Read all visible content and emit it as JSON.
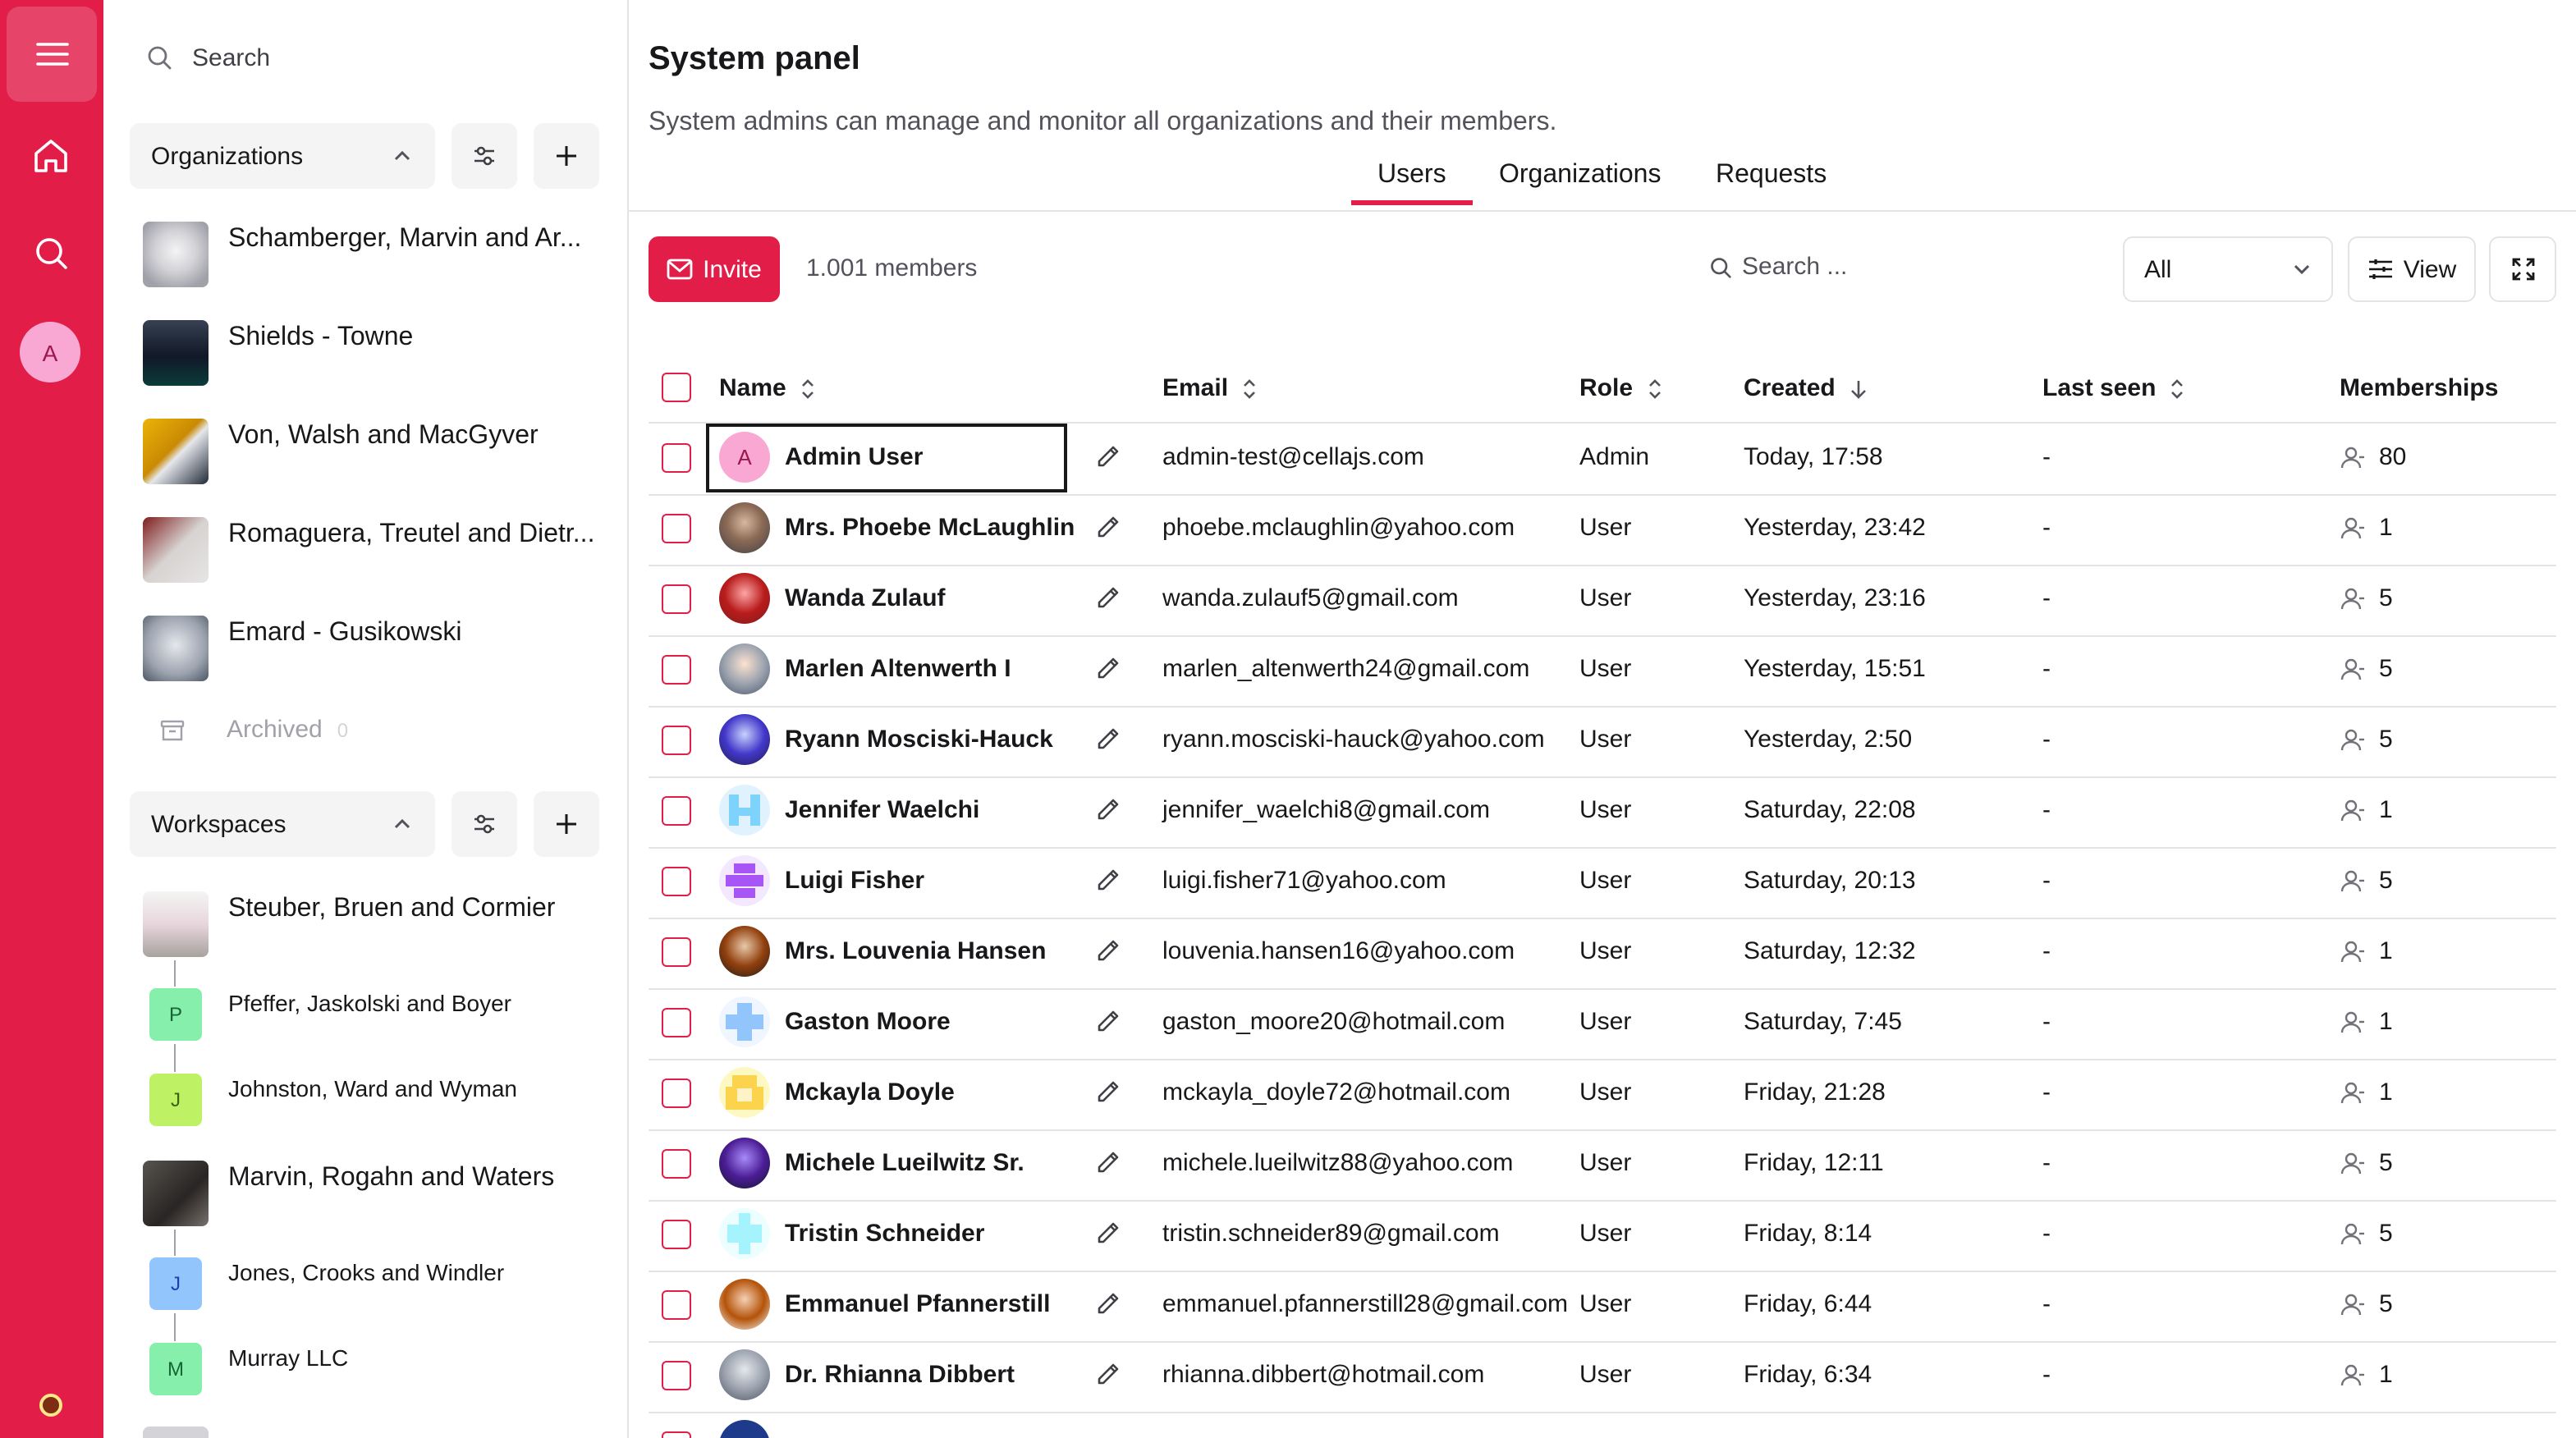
{
  "rail": {
    "avatar_initial": "A",
    "accent": "#e11d48"
  },
  "sidebar": {
    "search_placeholder": "Search",
    "organizations": {
      "title": "Organizations",
      "items": [
        {
          "name": "Schamberger, Marvin and Ar..."
        },
        {
          "name": "Shields - Towne"
        },
        {
          "name": "Von, Walsh and MacGyver"
        },
        {
          "name": "Romaguera, Treutel and Dietr..."
        },
        {
          "name": "Emard - Gusikowski"
        }
      ],
      "archived_label": "Archived",
      "archived_count": "0"
    },
    "workspaces": {
      "title": "Workspaces",
      "items": [
        {
          "name": "Steuber, Bruen and Cormier",
          "children": [
            {
              "initial": "P",
              "name": "Pfeffer, Jaskolski and Boyer"
            },
            {
              "initial": "J",
              "name": "Johnston, Ward and Wyman"
            }
          ]
        },
        {
          "name": "Marvin, Rogahn and Waters",
          "children": [
            {
              "initial": "J",
              "name": "Jones, Crooks and Windler"
            },
            {
              "initial": "M",
              "name": "Murray LLC"
            }
          ]
        }
      ]
    }
  },
  "main": {
    "title": "System panel",
    "description": "System admins can manage and monitor all organizations and their members.",
    "tabs": [
      {
        "label": "Users",
        "active": true
      },
      {
        "label": "Organizations",
        "active": false
      },
      {
        "label": "Requests",
        "active": false
      }
    ],
    "toolbar": {
      "invite_label": "Invite",
      "member_count": "1.001 members",
      "search_placeholder": "Search ...",
      "filter_value": "All",
      "view_label": "View"
    },
    "table": {
      "columns": [
        "Name",
        "Email",
        "Role",
        "Created",
        "Last seen",
        "Memberships"
      ],
      "rows": [
        {
          "name": "Admin User",
          "email": "admin-test@cellajs.com",
          "role": "Admin",
          "created": "Today, 17:58",
          "last_seen": "-",
          "memberships": "80",
          "avatar": "initial",
          "initial": "A"
        },
        {
          "name": "Mrs. Phoebe McLaughlin",
          "email": "phoebe.mclaughlin@yahoo.com",
          "role": "User",
          "created": "Yesterday, 23:42",
          "last_seen": "-",
          "memberships": "1",
          "avatar": "photo"
        },
        {
          "name": "Wanda Zulauf",
          "email": "wanda.zulauf5@gmail.com",
          "role": "User",
          "created": "Yesterday, 23:16",
          "last_seen": "-",
          "memberships": "5",
          "avatar": "photo"
        },
        {
          "name": "Marlen Altenwerth I",
          "email": "marlen_altenwerth24@gmail.com",
          "role": "User",
          "created": "Yesterday, 15:51",
          "last_seen": "-",
          "memberships": "5",
          "avatar": "photo"
        },
        {
          "name": "Ryann Mosciski-Hauck",
          "email": "ryann.mosciski-hauck@yahoo.com",
          "role": "User",
          "created": "Yesterday, 2:50",
          "last_seen": "-",
          "memberships": "5",
          "avatar": "photo"
        },
        {
          "name": "Jennifer Waelchi",
          "email": "jennifer_waelchi8@gmail.com",
          "role": "User",
          "created": "Saturday, 22:08",
          "last_seen": "-",
          "memberships": "1",
          "avatar": "pattern"
        },
        {
          "name": "Luigi Fisher",
          "email": "luigi.fisher71@yahoo.com",
          "role": "User",
          "created": "Saturday, 20:13",
          "last_seen": "-",
          "memberships": "5",
          "avatar": "pattern"
        },
        {
          "name": "Mrs. Louvenia Hansen",
          "email": "louvenia.hansen16@yahoo.com",
          "role": "User",
          "created": "Saturday, 12:32",
          "last_seen": "-",
          "memberships": "1",
          "avatar": "photo"
        },
        {
          "name": "Gaston Moore",
          "email": "gaston_moore20@hotmail.com",
          "role": "User",
          "created": "Saturday, 7:45",
          "last_seen": "-",
          "memberships": "1",
          "avatar": "pattern"
        },
        {
          "name": "Mckayla Doyle",
          "email": "mckayla_doyle72@hotmail.com",
          "role": "User",
          "created": "Friday, 21:28",
          "last_seen": "-",
          "memberships": "1",
          "avatar": "pattern"
        },
        {
          "name": "Michele Lueilwitz Sr.",
          "email": "michele.lueilwitz88@yahoo.com",
          "role": "User",
          "created": "Friday, 12:11",
          "last_seen": "-",
          "memberships": "5",
          "avatar": "photo"
        },
        {
          "name": "Tristin Schneider",
          "email": "tristin.schneider89@gmail.com",
          "role": "User",
          "created": "Friday, 8:14",
          "last_seen": "-",
          "memberships": "5",
          "avatar": "pattern"
        },
        {
          "name": "Emmanuel Pfannerstill",
          "email": "emmanuel.pfannerstill28@gmail.com",
          "role": "User",
          "created": "Friday, 6:44",
          "last_seen": "-",
          "memberships": "5",
          "avatar": "photo"
        },
        {
          "name": "Dr. Rhianna Dibbert",
          "email": "rhianna.dibbert@hotmail.com",
          "role": "User",
          "created": "Friday, 6:34",
          "last_seen": "-",
          "memberships": "1",
          "avatar": "photo"
        }
      ]
    }
  }
}
